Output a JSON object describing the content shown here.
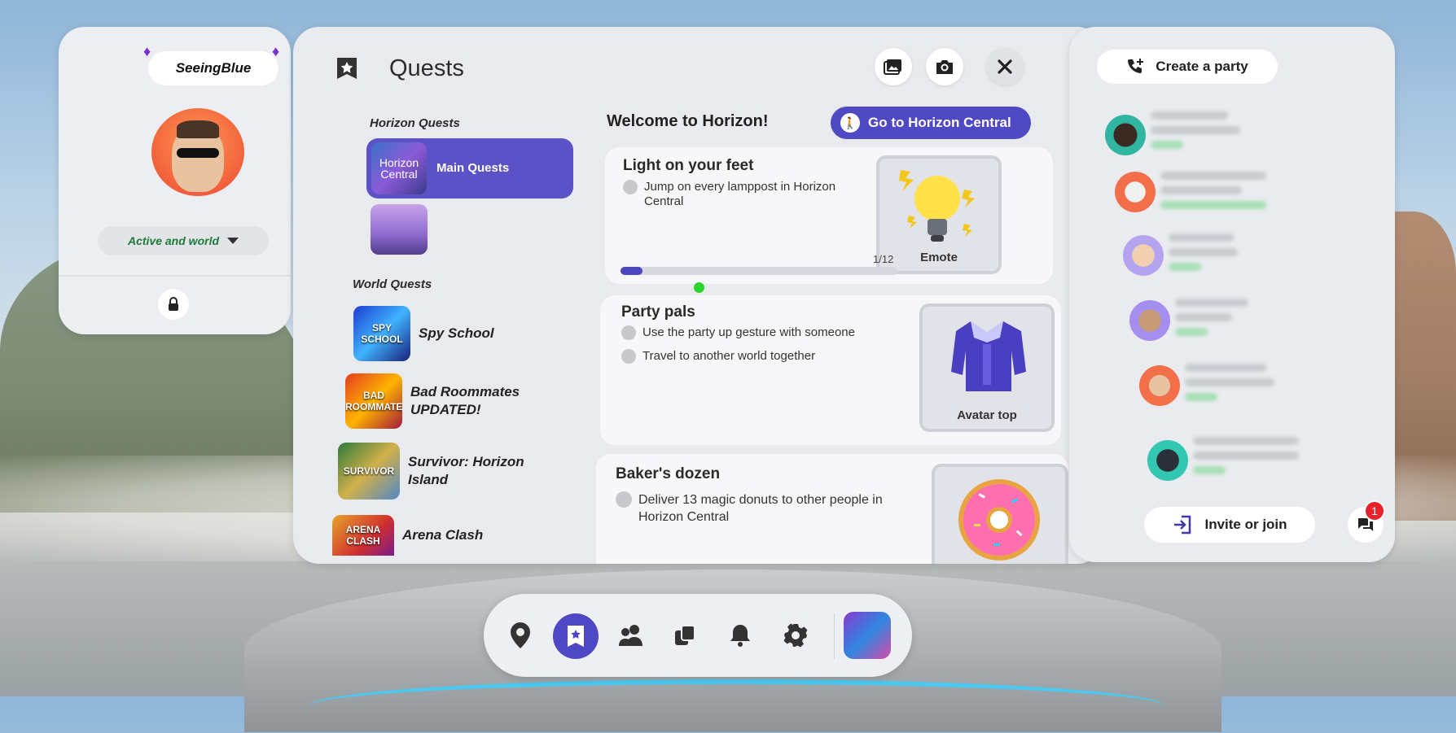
{
  "profile": {
    "username": "SeeingBlue",
    "status": "Active and world"
  },
  "quests": {
    "title": "Quests",
    "horizon_section": "Horizon Quests",
    "main_quest_thumb": "Horizon Central",
    "main_quest_label": "Main Quests",
    "world_section": "World Quests",
    "world_quests": [
      {
        "label": "Spy School",
        "thumb": "SPY SCHOOL"
      },
      {
        "label": "Bad Roommates UPDATED!",
        "thumb": "BAD ROOMMATES"
      },
      {
        "label": "Survivor: Horizon Island",
        "thumb": "SURVIVOR"
      },
      {
        "label": "Arena Clash",
        "thumb": "ARENA CLASH"
      }
    ],
    "welcome": "Welcome to Horizon!",
    "go_button": "Go to Horizon Central",
    "cards": [
      {
        "title": "Light on your feet",
        "tasks": [
          "Jump on every lamppost in Horizon Central"
        ],
        "progress_text": "1/12",
        "progress": 0.08,
        "reward": "Emote"
      },
      {
        "title": "Party pals",
        "tasks": [
          "Use the party up gesture with someone",
          "Travel to another world together"
        ],
        "reward": "Avatar top"
      },
      {
        "title": "Baker's dozen",
        "tasks": [
          "Deliver 13 magic donuts to other people in Horizon Central"
        ],
        "reward": ""
      }
    ]
  },
  "party": {
    "create_button": "Create a party",
    "invite_button": "Invite or join",
    "chat_badge": "1"
  }
}
